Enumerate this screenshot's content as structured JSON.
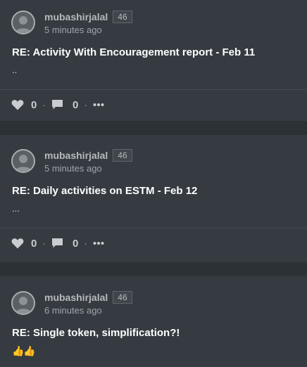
{
  "posts": [
    {
      "username": "mubashirjalal",
      "rank": "46",
      "time": "5 minutes ago",
      "title": "RE: Activity With Encouragement report - Feb 11",
      "body": "..",
      "likes": "0",
      "comments": "0"
    },
    {
      "username": "mubashirjalal",
      "rank": "46",
      "time": "5 minutes ago",
      "title": "RE: Daily activities on ESTM - Feb 12",
      "body": "...",
      "likes": "0",
      "comments": "0"
    },
    {
      "username": "mubashirjalal",
      "rank": "46",
      "time": "6 minutes ago",
      "title": "RE: Single token, simplification?!",
      "body": "👍👍"
    }
  ],
  "icons": {
    "like": "heart-icon",
    "comment": "comment-icon",
    "more": "more-icon",
    "avatar": "avatar-placeholder"
  },
  "colors": {
    "background": "#2c3135",
    "card": "#353b41",
    "text": "#ffffff",
    "muted": "#a0a5aa"
  }
}
